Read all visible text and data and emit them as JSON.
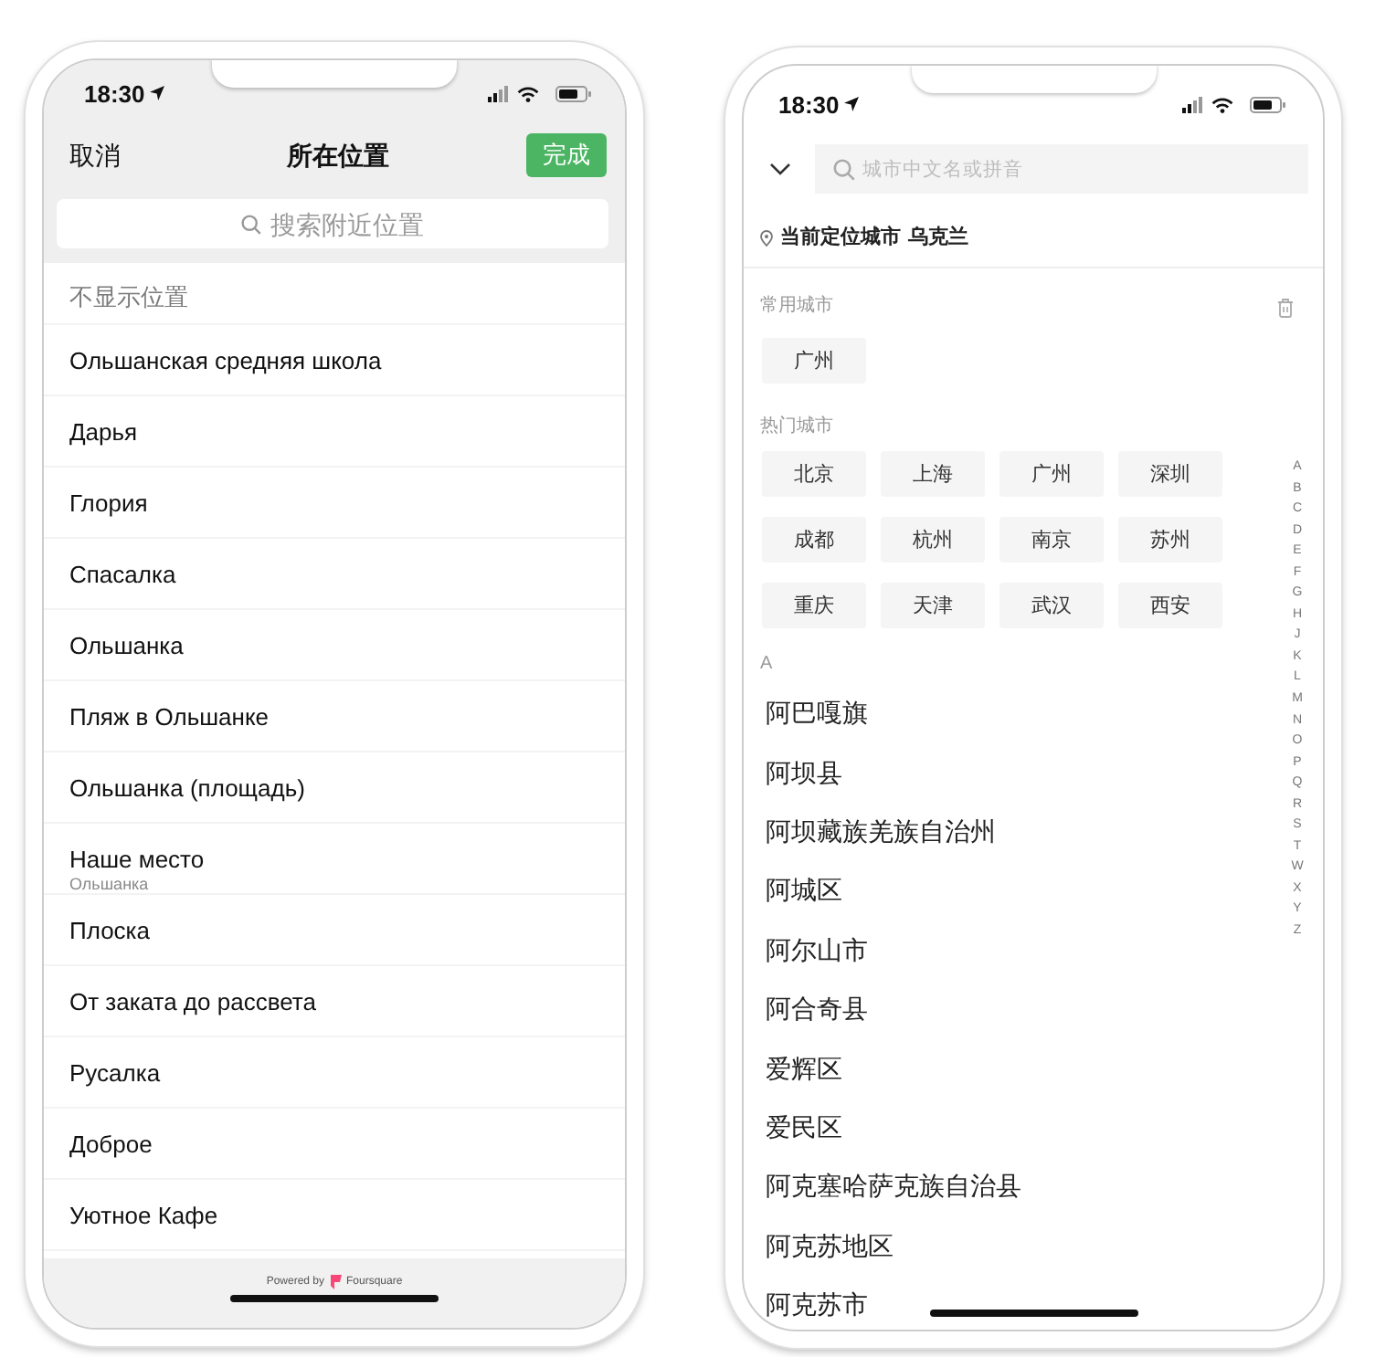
{
  "location_picker": {
    "status_bar": {
      "time": "18:30"
    },
    "nav_bar": {
      "cancel": "取消",
      "title": "所在位置",
      "done": "完成"
    },
    "search": {
      "placeholder": "搜索附近位置"
    },
    "places": [
      {
        "kind": "option",
        "name": "不显示位置"
      },
      {
        "kind": "place",
        "name": "Ольшанская средняя школа"
      },
      {
        "kind": "place",
        "name": "Дарья"
      },
      {
        "kind": "place",
        "name": "Глория"
      },
      {
        "kind": "place",
        "name": "Спасалка"
      },
      {
        "kind": "place",
        "name": "Ольшанка"
      },
      {
        "kind": "place",
        "name": "Пляж в Ольшанке"
      },
      {
        "kind": "place",
        "name": "Ольшанка (площадь)"
      },
      {
        "kind": "place",
        "name": "Наше место",
        "address": "Ольшанка"
      },
      {
        "kind": "place",
        "name": "Плоска"
      },
      {
        "kind": "place",
        "name": "От заката до рассвета"
      },
      {
        "kind": "place",
        "name": "Русалка"
      },
      {
        "kind": "place",
        "name": "Доброе"
      },
      {
        "kind": "place",
        "name": "Уютное Кафе"
      }
    ],
    "footer": {
      "powered_by": "Powered by",
      "provider": "Foursquare"
    }
  },
  "city_picker": {
    "status_bar": {
      "time": "18:30"
    },
    "search": {
      "placeholder": "城市中文名或拼音"
    },
    "current_location": {
      "label": "当前定位城市",
      "city": "乌克兰"
    },
    "recent": {
      "title": "常用城市",
      "cities": [
        "广州"
      ]
    },
    "hot": {
      "title": "热门城市",
      "cities": [
        "北京",
        "上海",
        "广州",
        "深圳",
        "成都",
        "杭州",
        "南京",
        "苏州",
        "重庆",
        "天津",
        "武汉",
        "西安"
      ]
    },
    "sections": [
      {
        "letter": "A",
        "cities": [
          "阿巴嘎旗",
          "阿坝县",
          "阿坝藏族羌族自治州",
          "阿城区",
          "阿尔山市",
          "阿合奇县",
          "爱辉区",
          "爱民区",
          "阿克塞哈萨克族自治县",
          "阿克苏地区",
          "阿克苏市"
        ]
      }
    ],
    "index": [
      "A",
      "B",
      "C",
      "D",
      "E",
      "F",
      "G",
      "H",
      "J",
      "K",
      "L",
      "M",
      "N",
      "O",
      "P",
      "Q",
      "R",
      "S",
      "T",
      "W",
      "X",
      "Y",
      "Z"
    ]
  }
}
